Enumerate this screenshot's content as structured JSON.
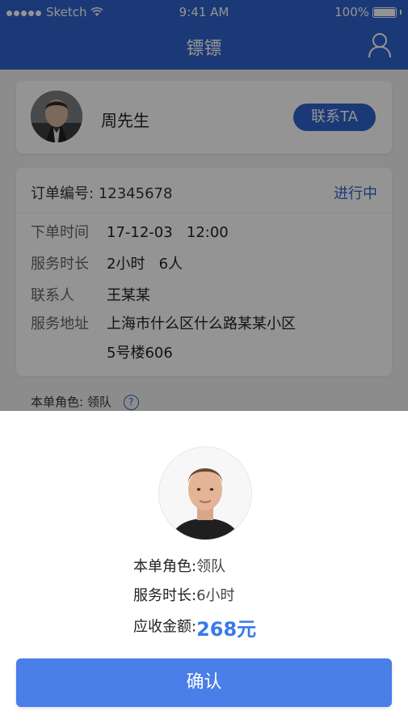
{
  "status_bar": {
    "carrier": "Sketch",
    "time": "9:41 AM",
    "battery": "100%"
  },
  "nav": {
    "title": "镖镖",
    "user_icon": "person-outline-icon"
  },
  "contact": {
    "name": "周先生",
    "button_label": "联系TA"
  },
  "order": {
    "number_label": "订单编号:",
    "number": "12345678",
    "status": "进行中",
    "rows": [
      {
        "key": "下单时间",
        "value": "17-12-03   12:00"
      },
      {
        "key": "服务时长",
        "value": "2小时   6人"
      },
      {
        "key": "联系人",
        "value": "王某某"
      },
      {
        "key": "服务地址",
        "value": "上海市什么区什么路某某小区",
        "value2": "5号楼606"
      }
    ]
  },
  "role_line": {
    "label": "本单角色:",
    "value": "领队"
  },
  "sheet": {
    "role_label": "本单角色:",
    "role_value": "领队",
    "duration_label": "服务时长:",
    "duration_value": "6小时",
    "amount_label": "应收金额:",
    "amount_value": "268元",
    "confirm_label": "确认"
  },
  "colors": {
    "primary": "#2f62cc",
    "confirm": "#4a7ee8",
    "amount": "#3a79e9"
  }
}
